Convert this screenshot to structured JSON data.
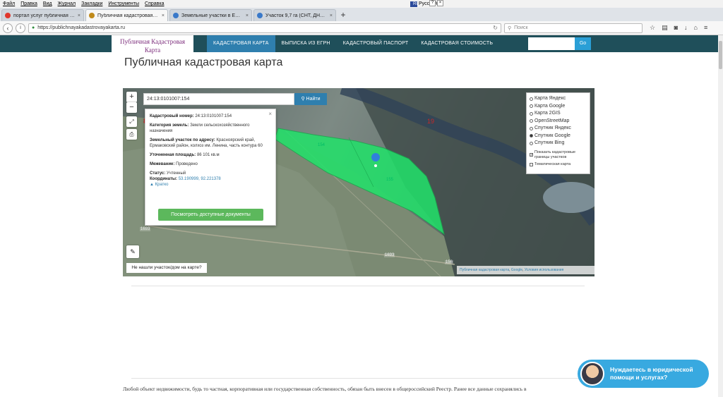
{
  "menubar": {
    "items": [
      "Файл",
      "Правка",
      "Вид",
      "Журнал",
      "Закладки",
      "Инструменты",
      "Справка"
    ],
    "language": "Русский",
    "lang_code": "RU"
  },
  "tabs": [
    {
      "title": "портал услуг публичная ка...",
      "favicon_color": "#e0372d"
    },
    {
      "title": "Публичная кадастровая к...",
      "favicon_color": "#c08a1b",
      "active": true
    },
    {
      "title": "Земельные участки в Ерма...",
      "favicon_color": "#3a79c9"
    },
    {
      "title": "Участок 9,7 га (СНТ, ДНП) ...",
      "favicon_color": "#3a79c9"
    }
  ],
  "navbar": {
    "url": "https://publichnayakadastrovayakarta.ru",
    "search_placeholder": "Поиск"
  },
  "site": {
    "logo_line1": "Публичная Кадастровая",
    "logo_line2": "Карта",
    "nav": [
      "КАДАСТРОВАЯ КАРТА",
      "ВЫПИСКА ИЗ ЕГРН",
      "КАДАСТРОВЫЙ ПАСПОРТ",
      "КАДАСТРОВАЯ СТОИМОСТЬ"
    ],
    "go_label": "Go",
    "page_title": "Публичная кадастровая карта"
  },
  "map": {
    "search_value": "24:13:0101007:154",
    "search_button": "Найти",
    "popup": {
      "cadastral_label": "Кадастровый номер:",
      "cadastral_value": "24:13:0101007:154",
      "category_label": "Категория земель:",
      "category_value": "Земли сельскохозяйственного назначения",
      "address_label": "Земельный участок по адресу:",
      "address_value": "Красноярский край, Ермаковский район, колхоз им. Ленина, часть контура 60",
      "area_label": "Уточненная площадь:",
      "area_value": "86 101 кв.м",
      "survey_label": "Межевание:",
      "survey_value": "Проведено",
      "status_label": "Статус:",
      "status_value": "Учтенный",
      "coords_label": "Координаты:",
      "coords_value": "53.190999, 92.221378",
      "brief_link": "Кратко",
      "docs_button": "Посмотреть доступные документы"
    },
    "layers": [
      {
        "label": "Карта Яндекс",
        "selected": false
      },
      {
        "label": "Карта Google",
        "selected": false
      },
      {
        "label": "Карта 2GIS",
        "selected": false
      },
      {
        "label": "OpenStreetMap",
        "selected": false
      },
      {
        "label": "Спутник Яндекс",
        "selected": false
      },
      {
        "label": "Спутник Google",
        "selected": true
      },
      {
        "label": "Спутник Bing",
        "selected": false
      }
    ],
    "show_borders": "Показать кадастровые границы участков",
    "thematic_map": "Тематическая карта",
    "not_found": "Не нашли участок/дом на карте?",
    "attribution_1": "Публичная кадастровая карта",
    "attribution_2": "Google",
    "attribution_3": "Условия использования",
    "labels": {
      "l1693a": "1693",
      "l1693b": "1693",
      "l156": "156",
      "l154": "154",
      "l155": "155",
      "l19": "19",
      "l8": "8"
    }
  },
  "body_text": "Любой объект недвижимости, будь то частная, корпоративная или государственная собственность, обязан быть внесен в общероссийский Реестр. Ранее все данные сохранялись в",
  "help": {
    "line1": "Нуждаетесь в юридической",
    "line2": "помощи и услугах?"
  }
}
